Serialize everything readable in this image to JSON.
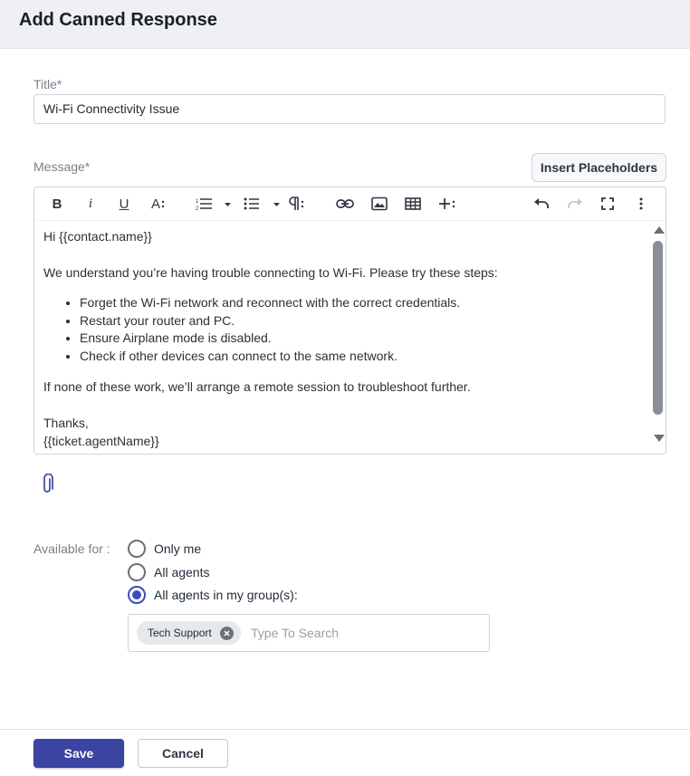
{
  "header": {
    "title": "Add Canned Response"
  },
  "title_field": {
    "label": "Title*",
    "value": "Wi-Fi Connectivity Issue"
  },
  "message_field": {
    "label": "Message*",
    "insert_placeholders_label": "Insert Placeholders",
    "toolbar": {
      "bold": "B",
      "italic": "i",
      "underline": "U",
      "font_size": "A",
      "icons": [
        "bold-icon",
        "italic-icon",
        "underline-icon",
        "font-size-icon",
        "ordered-list-icon",
        "unordered-list-icon",
        "paragraph-format-icon",
        "link-icon",
        "image-icon",
        "table-icon",
        "insert-more-icon",
        "undo-icon",
        "redo-icon",
        "fullscreen-icon",
        "more-options-icon"
      ]
    },
    "body": {
      "greeting": "Hi {{contact.name}}",
      "intro": "We understand you’re having trouble connecting to Wi-Fi. Please try these steps:",
      "steps": [
        "Forget the Wi-Fi network and reconnect with the correct credentials.",
        "Restart your router and PC.",
        "Ensure Airplane mode is disabled.",
        "Check if other devices can connect to the same network."
      ],
      "followup": "If none of these work, we’ll arrange a remote session to troubleshoot further.",
      "signoff": "Thanks,",
      "signature": "{{ticket.agentName}}"
    }
  },
  "availability": {
    "label": "Available for :",
    "options": [
      "Only me",
      "All agents",
      "All agents in my group(s):"
    ],
    "selected": "All agents in my group(s):",
    "groups": {
      "chips": [
        "Tech Support"
      ],
      "placeholder": "Type To Search"
    }
  },
  "footer": {
    "save_label": "Save",
    "cancel_label": "Cancel"
  },
  "colors": {
    "primary": "#3b44a0",
    "radio_selected": "#3b4bb8",
    "header_bg": "#eef0f3"
  }
}
